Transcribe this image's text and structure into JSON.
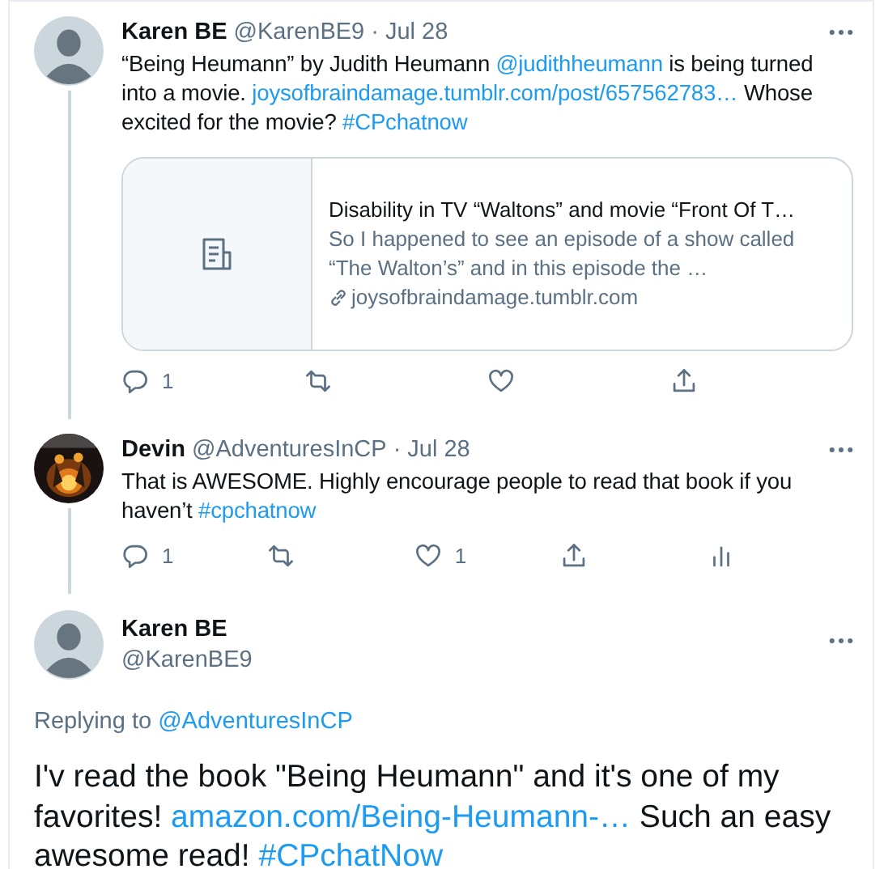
{
  "tweets": [
    {
      "name": "Karen BE",
      "handle": "@KarenBE9",
      "separator": "·",
      "date": "Jul 28",
      "avatar": {
        "kind": "default"
      },
      "thread_line": true,
      "body": [
        {
          "kind": "text",
          "text": "“Being Heumann” by Judith Heumann "
        },
        {
          "kind": "link",
          "text": "@judithheumann"
        },
        {
          "kind": "text",
          "text": "  is being turned into a movie. "
        },
        {
          "kind": "link",
          "text": "joysofbraindamage.tumblr.com/post/657562783…"
        },
        {
          "kind": "text",
          "text": " Whose excited for the movie? "
        },
        {
          "kind": "link",
          "text": "#CPchatnow"
        }
      ],
      "card": {
        "title": "Disability in TV “Waltons” and movie “Front Of T…",
        "description": "So I happened to see an episode of a show called “The Walton’s” and in this episode the …",
        "domain": "joysofbraindamage.tumblr.com"
      },
      "actions": [
        {
          "kind": "reply",
          "count": "1"
        },
        {
          "kind": "retweet"
        },
        {
          "kind": "like"
        },
        {
          "kind": "share"
        }
      ]
    },
    {
      "name": "Devin",
      "handle": "@AdventuresInCP",
      "separator": "·",
      "date": "Jul 28",
      "avatar": {
        "kind": "picture"
      },
      "thread_line": true,
      "body": [
        {
          "kind": "text",
          "text": "That is AWESOME. Highly encourage people to read that book if you haven’t "
        },
        {
          "kind": "link",
          "text": "#cpchatnow"
        }
      ],
      "actions": [
        {
          "kind": "reply",
          "count": "1"
        },
        {
          "kind": "retweet"
        },
        {
          "kind": "like",
          "count": "1"
        },
        {
          "kind": "share"
        },
        {
          "kind": "analytics"
        }
      ]
    }
  ],
  "main_tweet": {
    "name": "Karen BE",
    "handle": "@KarenBE9",
    "replying_label": "Replying to",
    "replying_to": "@AdventuresInCP",
    "body": [
      {
        "kind": "text",
        "text": "I'v read the book \"Being Heumann\" and it's one of my favorites! "
      },
      {
        "kind": "link",
        "text": "amazon.com/Being-Heumann-…"
      },
      {
        "kind": "text",
        "text": " Such an easy awesome read! "
      },
      {
        "kind": "link",
        "text": "#CPchatNow"
      }
    ]
  }
}
